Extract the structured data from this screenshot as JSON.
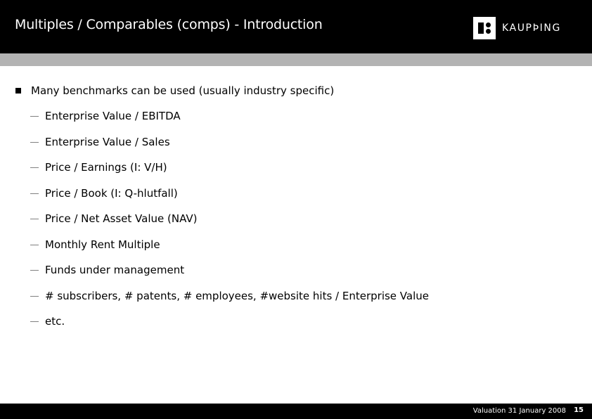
{
  "header": {
    "title": "Multiples / Comparables (comps) - Introduction",
    "logo": {
      "icon": "kaupthing-logo-icon",
      "text": "KAUPÞING"
    }
  },
  "content": {
    "main_bullet": "Many benchmarks can be used (usually industry specific)",
    "sub_items": [
      "Enterprise Value / EBITDA",
      "Enterprise Value / Sales",
      "Price / Earnings (I: V/H)",
      "Price / Book (I: Q-hlutfall)",
      "Price / Net Asset Value (NAV)",
      "Monthly Rent Multiple",
      "Funds under management",
      "# subscribers, # patents, # employees, #website hits / Enterprise Value",
      "etc."
    ]
  },
  "footer": {
    "text": "Valuation 31 January 2008",
    "page_number": "15"
  },
  "colors": {
    "header_bg": "#000000",
    "band": "#b3b3b3",
    "footer_bg": "#000000"
  }
}
